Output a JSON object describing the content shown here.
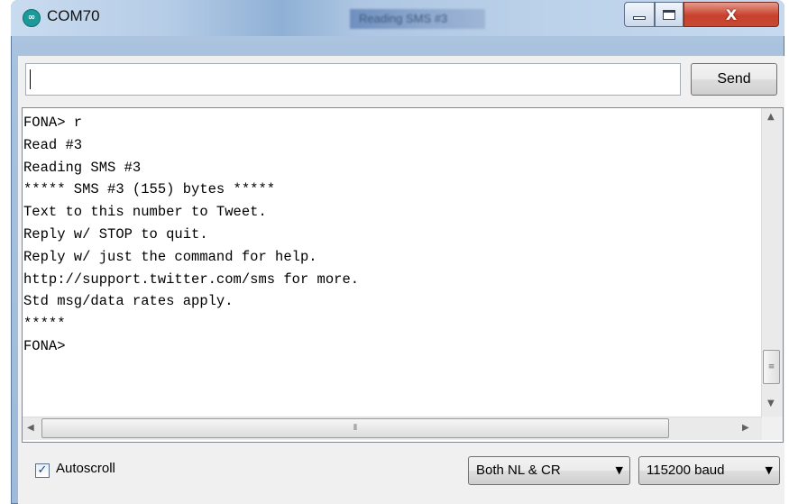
{
  "window": {
    "title": "COM70",
    "app_icon": "arduino-infinity-icon",
    "blurred_background_text": "Reading SMS #3",
    "controls": {
      "minimize": "minimize-icon",
      "maximize": "maximize-icon",
      "close_glyph": "X"
    }
  },
  "send_bar": {
    "input_value": "",
    "send_label": "Send"
  },
  "serial_output": {
    "lines": [
      "FONA> r",
      "Read #3",
      "Reading SMS #3",
      "***** SMS #3 (155) bytes *****",
      "Text to this number to Tweet.",
      "Reply w/ STOP to quit.",
      "Reply w/ just the command for help.",
      "http://support.twitter.com/sms for more.",
      "Std msg/data rates apply.",
      "*****",
      "FONA>"
    ]
  },
  "bottom_bar": {
    "autoscroll_label": "Autoscroll",
    "autoscroll_checked": true,
    "line_ending": "Both NL & CR",
    "baud_rate": "115200 baud"
  },
  "colors": {
    "close_button": "#c9402b",
    "title_bar": "#b6cde7",
    "client_bg": "#f0f0f0"
  }
}
